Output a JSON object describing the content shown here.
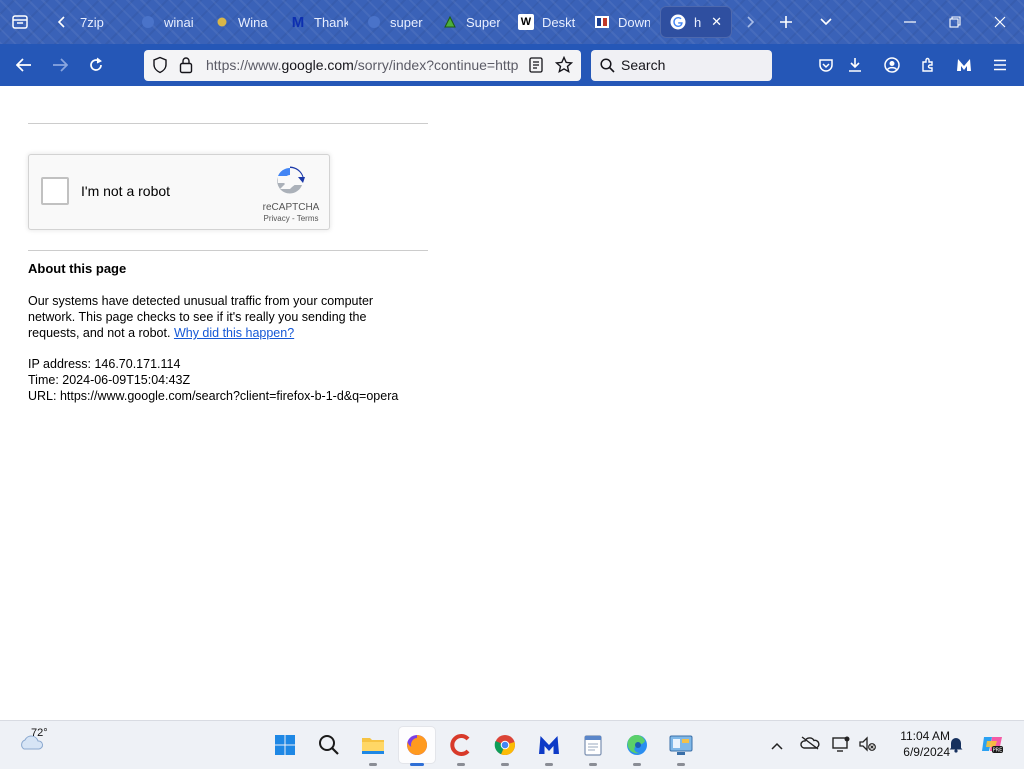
{
  "browser": {
    "tabs": [
      {
        "label": "7zip",
        "icon": "none"
      },
      {
        "label": "winai",
        "icon": "globe-icon"
      },
      {
        "label": "Wina",
        "icon": "dot-icon"
      },
      {
        "label": "Thank",
        "icon": "malwarebytes-icon"
      },
      {
        "label": "super",
        "icon": "globe-icon"
      },
      {
        "label": "Super",
        "icon": "frog-icon"
      },
      {
        "label": "Deskt",
        "icon": "w-icon"
      },
      {
        "label": "Down",
        "icon": "book-icon"
      },
      {
        "label": "htt",
        "icon": "google-g-icon",
        "active": true
      }
    ],
    "url_prefix": "https://www.",
    "url_domain": "google.com",
    "url_rest": "/sorry/index?continue=http",
    "search_placeholder": "Search"
  },
  "captcha": {
    "label": "I'm not a robot",
    "brand": "reCAPTCHA",
    "privacy": "Privacy",
    "separator": " - ",
    "terms": "Terms"
  },
  "about": {
    "title": "About this page",
    "paragraph": "Our systems have detected unusual traffic from your computer network. This page checks to see if it's really you sending the requests, and not a robot.",
    "link": "Why did this happen?",
    "ip": "IP address: 146.70.171.114",
    "time": "Time: 2024-06-09T15:04:43Z",
    "url": "URL: https://www.google.com/search?client=firefox-b-1-d&q=opera"
  },
  "taskbar": {
    "weather_temp": "72°",
    "time": "11:04 AM",
    "date": "6/9/2024",
    "colors": {
      "accent": "#2f6fd6",
      "browser_chrome": "#2557b7",
      "link": "#1558d6"
    }
  }
}
